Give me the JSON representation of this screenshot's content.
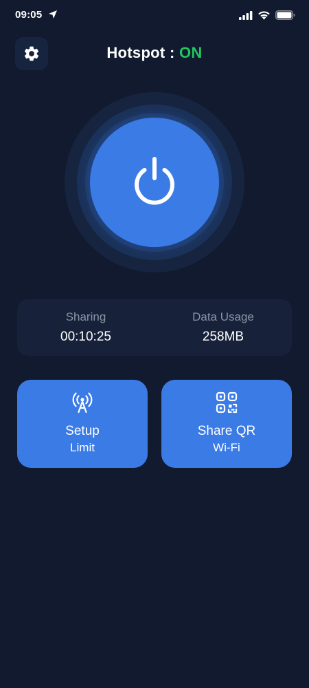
{
  "status_bar": {
    "time": "09:05",
    "icons": [
      "location-arrow-icon",
      "cellular-signal-icon",
      "wifi-icon",
      "battery-icon"
    ]
  },
  "header": {
    "title_prefix": "Hotspot : ",
    "state": "ON",
    "settings_icon": "gear-icon"
  },
  "power": {
    "icon": "power-icon"
  },
  "stats": {
    "sharing_label": "Sharing",
    "sharing_value": "00:10:25",
    "usage_label": "Data Usage",
    "usage_value": "258MB"
  },
  "actions": [
    {
      "icon": "antenna-icon",
      "line1": "Setup",
      "line2": "Limit"
    },
    {
      "icon": "qr-code-icon",
      "line1": "Share QR",
      "line2": "Wi-Fi"
    }
  ],
  "colors": {
    "background": "#111a2e",
    "accent": "#3a7be6",
    "card": "#17223a",
    "on_state": "#22c55e",
    "muted_text": "#8a93a6"
  }
}
